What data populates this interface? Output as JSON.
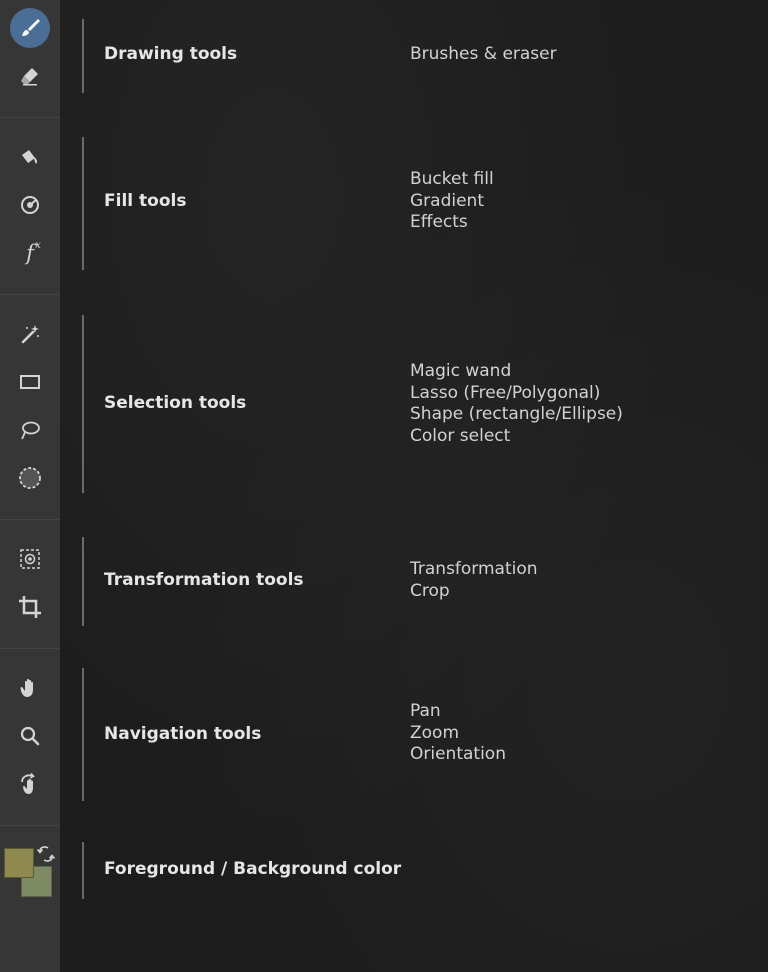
{
  "sections": [
    {
      "title": "Drawing tools",
      "items": [
        "Brushes & eraser"
      ]
    },
    {
      "title": "Fill tools",
      "items": [
        "Bucket fill",
        "Gradient",
        "Effects"
      ]
    },
    {
      "title": "Selection tools",
      "items": [
        "Magic wand",
        "Lasso (Free/Polygonal)",
        "Shape (rectangle/Ellipse)",
        "Color select"
      ]
    },
    {
      "title": "Transformation tools",
      "items": [
        "Transformation",
        "Crop"
      ]
    },
    {
      "title": "Navigation tools",
      "items": [
        "Pan",
        "Zoom",
        "Orientation"
      ]
    },
    {
      "title": "Foreground / Background color",
      "items": []
    }
  ],
  "toolbar": {
    "fx_label": "f",
    "fx_sup": "x",
    "icons": [
      "brush-icon",
      "eraser-icon",
      "bucket-fill-icon",
      "gradient-icon",
      "effects-icon",
      "magic-wand-icon",
      "rectangle-select-icon",
      "lasso-icon",
      "ellipse-select-icon",
      "transform-icon",
      "crop-icon",
      "pan-hand-icon",
      "zoom-icon",
      "rotate-hand-icon",
      "swap-colors-icon"
    ]
  },
  "colors": {
    "accent": "#4b6e96",
    "foreground": "#8e8a4f",
    "background": "#7d8a64",
    "toolbar_bg": "#363636",
    "canvas_bg": "#1c1c1c"
  }
}
